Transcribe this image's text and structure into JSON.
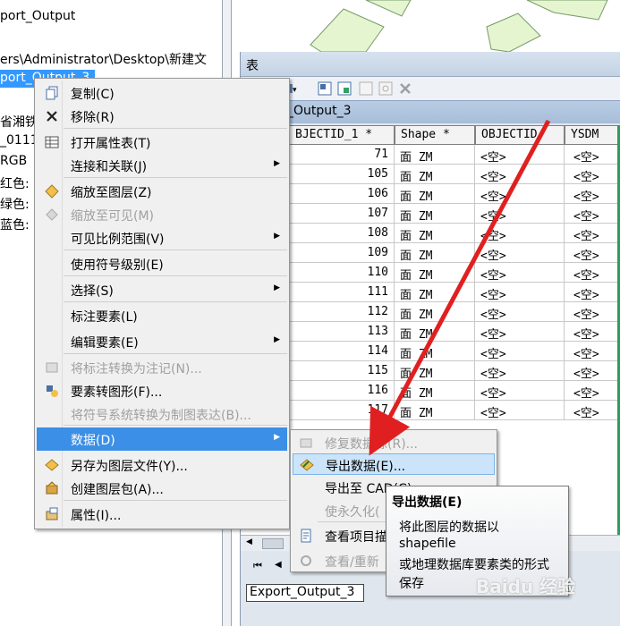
{
  "toc": {
    "layer_name_top": "port_Output",
    "path": "ers\\Administrator\\Desktop\\新建文",
    "selected_layer": "port_Output_3",
    "fragments": [
      "省湘铁路",
      "_0111",
      "RGB",
      "红色:",
      "绿色: B",
      "蓝色:"
    ]
  },
  "table_window": {
    "title": "表",
    "tab_name": "_Output_3",
    "columns": [
      "BJECTID_1 *",
      "Shape *",
      "OBJECTID",
      "YSDM"
    ],
    "rows": [
      {
        "id": "71",
        "shape": "面 ZM",
        "objectid": "<空>",
        "ysdm": "<空>"
      },
      {
        "id": "105",
        "shape": "面 ZM",
        "objectid": "<空>",
        "ysdm": "<空>"
      },
      {
        "id": "106",
        "shape": "面 ZM",
        "objectid": "<空>",
        "ysdm": "<空>"
      },
      {
        "id": "107",
        "shape": "面 ZM",
        "objectid": "<空>",
        "ysdm": "<空>"
      },
      {
        "id": "108",
        "shape": "面 ZM",
        "objectid": "<空>",
        "ysdm": "<空>"
      },
      {
        "id": "109",
        "shape": "面 ZM",
        "objectid": "<空>",
        "ysdm": "<空>"
      },
      {
        "id": "110",
        "shape": "面 ZM",
        "objectid": "<空>",
        "ysdm": "<空>"
      },
      {
        "id": "111",
        "shape": "面 ZM",
        "objectid": "<空>",
        "ysdm": "<空>"
      },
      {
        "id": "112",
        "shape": "面 ZM",
        "objectid": "<空>",
        "ysdm": "<空>"
      },
      {
        "id": "113",
        "shape": "面 ZM",
        "objectid": "<空>",
        "ysdm": "<空>"
      },
      {
        "id": "114",
        "shape": "面 ZM",
        "objectid": "<空>",
        "ysdm": "<空>"
      },
      {
        "id": "115",
        "shape": "面 ZM",
        "objectid": "<空>",
        "ysdm": "<空>"
      },
      {
        "id": "116",
        "shape": "面 ZM",
        "objectid": "<空>",
        "ysdm": "<空>"
      },
      {
        "id": "117",
        "shape": "面 ZM",
        "objectid": "<空>",
        "ysdm": "<空>"
      }
    ],
    "bottom_tab": "Export_Output_3"
  },
  "context_menu": {
    "items": [
      {
        "label": "复制(C)",
        "icon": "copy-icon",
        "disabled": false,
        "submenu": false
      },
      {
        "label": "移除(R)",
        "icon": "remove-icon",
        "disabled": false,
        "submenu": false
      },
      {
        "label": "打开属性表(T)",
        "icon": "table-icon",
        "disabled": false,
        "submenu": false
      },
      {
        "label": "连接和关联(J)",
        "icon": "",
        "disabled": false,
        "submenu": true
      },
      {
        "label": "缩放至图层(Z)",
        "icon": "zoom-layer-icon",
        "disabled": false,
        "submenu": false
      },
      {
        "label": "缩放至可见(M)",
        "icon": "zoom-visible-icon",
        "disabled": true,
        "submenu": false
      },
      {
        "label": "可见比例范围(V)",
        "icon": "",
        "disabled": false,
        "submenu": true
      },
      {
        "label": "使用符号级别(E)",
        "icon": "",
        "disabled": false,
        "submenu": false
      },
      {
        "label": "选择(S)",
        "icon": "",
        "disabled": false,
        "submenu": true
      },
      {
        "label": "标注要素(L)",
        "icon": "",
        "disabled": false,
        "submenu": false
      },
      {
        "label": "编辑要素(E)",
        "icon": "",
        "disabled": false,
        "submenu": true
      },
      {
        "label": "将标注转换为注记(N)...",
        "icon": "convert-label-icon",
        "disabled": true,
        "submenu": false
      },
      {
        "label": "要素转图形(F)...",
        "icon": "feature-graphic-icon",
        "disabled": false,
        "submenu": false
      },
      {
        "label": "将符号系统转换为制图表达(B)...",
        "icon": "",
        "disabled": true,
        "submenu": false
      },
      {
        "label": "数据(D)",
        "icon": "",
        "disabled": false,
        "submenu": true,
        "highlighted": true
      },
      {
        "label": "另存为图层文件(Y)...",
        "icon": "layer-file-icon",
        "disabled": false,
        "submenu": false
      },
      {
        "label": "创建图层包(A)...",
        "icon": "layer-package-icon",
        "disabled": false,
        "submenu": false
      },
      {
        "label": "属性(I)...",
        "icon": "properties-icon",
        "disabled": false,
        "submenu": false
      }
    ]
  },
  "submenu": {
    "items": [
      {
        "label": "修复数据源(R)...",
        "disabled": true
      },
      {
        "label": "导出数据(E)...",
        "disabled": false,
        "highlighted": true
      },
      {
        "label": "导出至 CAD(C)...",
        "disabled": false
      },
      {
        "label": "使永久化(",
        "disabled": true
      },
      {
        "label": "查看项目描",
        "disabled": false
      },
      {
        "label": "查看/重新",
        "disabled": true
      }
    ]
  },
  "tooltip": {
    "title": "导出数据(E)",
    "lines": [
      "将此图层的数据以",
      "shapefile",
      "或地理数据库要素类的形式",
      "保存"
    ]
  },
  "watermark": "Baidu 经验",
  "colors": {
    "menu_highlight": "#3b8fe6",
    "selection": "#3399ff",
    "arrow": "#e02020"
  }
}
